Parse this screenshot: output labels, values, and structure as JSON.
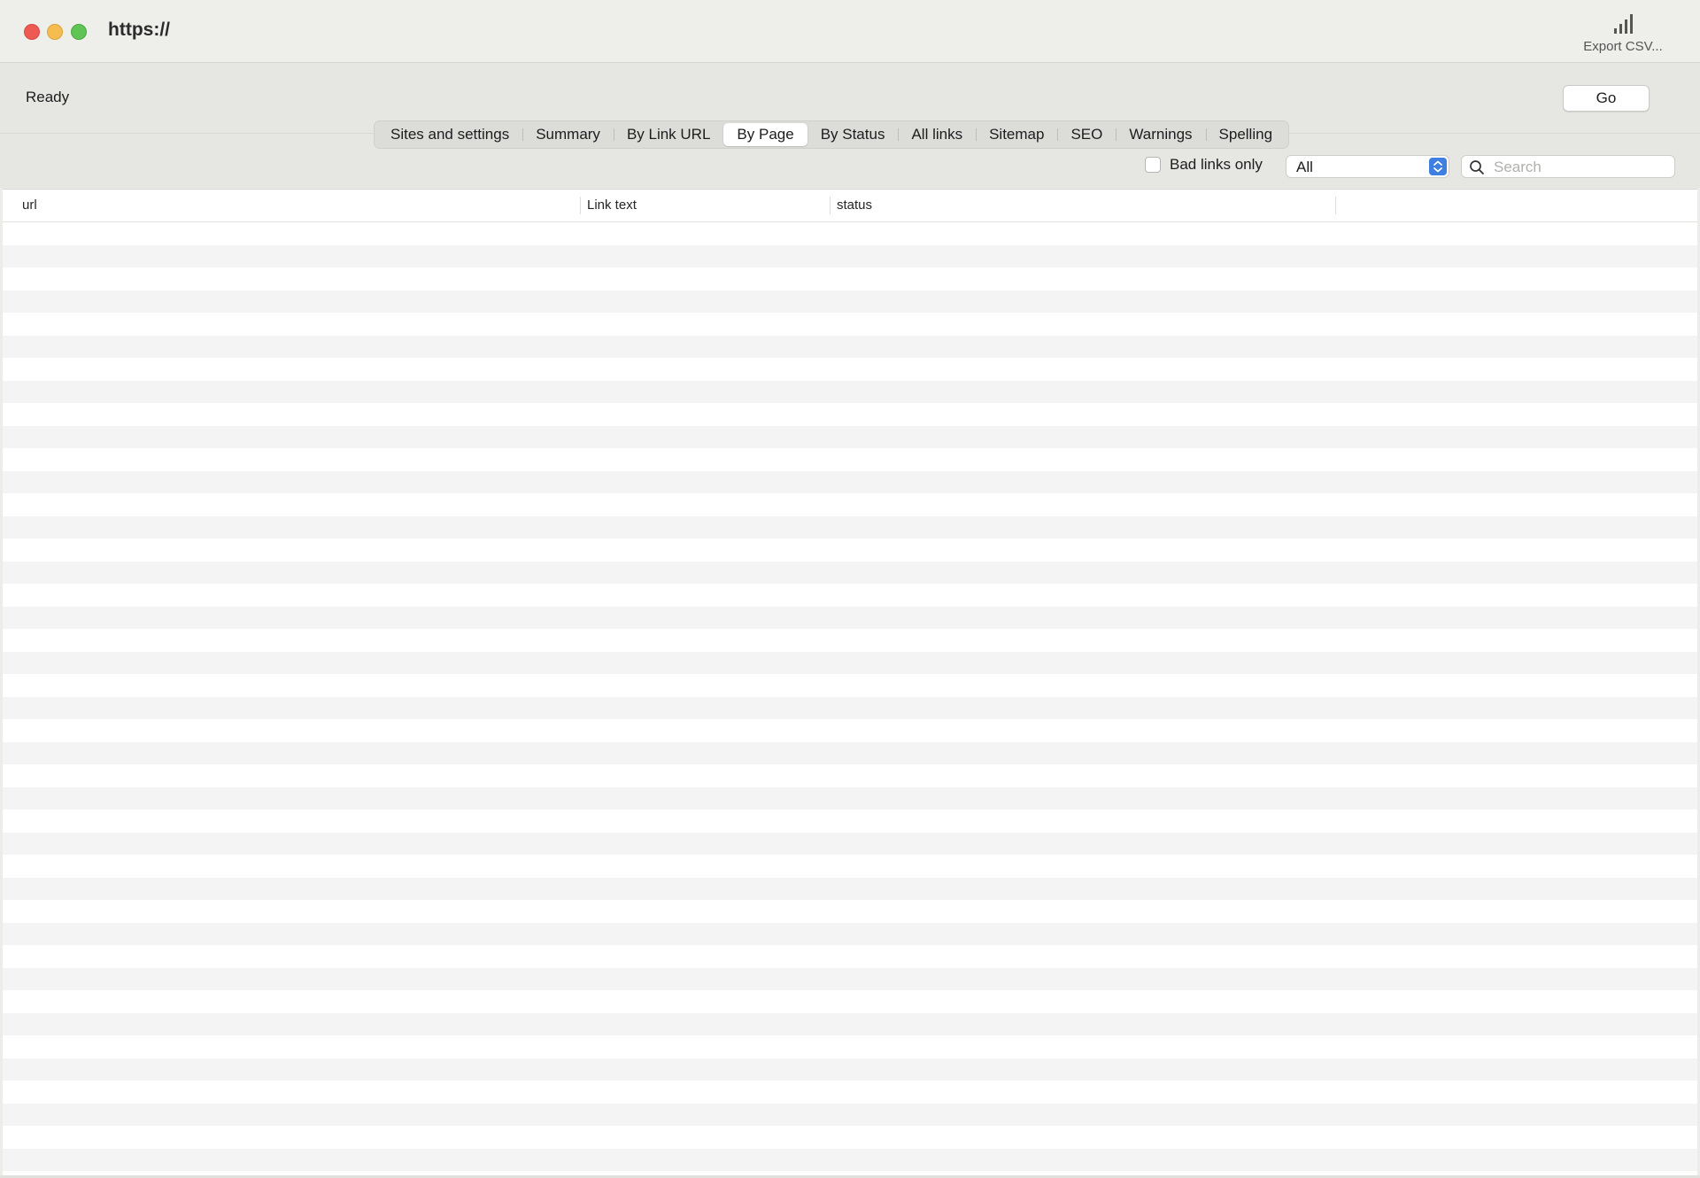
{
  "window": {
    "title": "https://",
    "export_label": "Export CSV..."
  },
  "toolbar": {
    "status": "Ready",
    "go_label": "Go"
  },
  "tabs": [
    {
      "label": "Sites and settings",
      "selected": false
    },
    {
      "label": "Summary",
      "selected": false
    },
    {
      "label": "By Link URL",
      "selected": false
    },
    {
      "label": "By Page",
      "selected": true
    },
    {
      "label": "By Status",
      "selected": false
    },
    {
      "label": "All links",
      "selected": false
    },
    {
      "label": "Sitemap",
      "selected": false
    },
    {
      "label": "SEO",
      "selected": false
    },
    {
      "label": "Warnings",
      "selected": false
    },
    {
      "label": "Spelling",
      "selected": false
    }
  ],
  "filters": {
    "bad_links_label": "Bad links only",
    "bad_links_checked": false,
    "select_value": "All",
    "search_placeholder": "Search",
    "search_value": ""
  },
  "table": {
    "columns": [
      "url",
      "Link text",
      "status"
    ],
    "rows": []
  },
  "colors": {
    "accent": "#3f7fe0",
    "close": "#ee5a52",
    "minimize": "#f5bd4f",
    "maximize": "#5ec454"
  },
  "icons": {
    "export": "signal-bars-icon",
    "search": "magnifier-icon",
    "select_stepper": "up-down-chevron-icon"
  }
}
